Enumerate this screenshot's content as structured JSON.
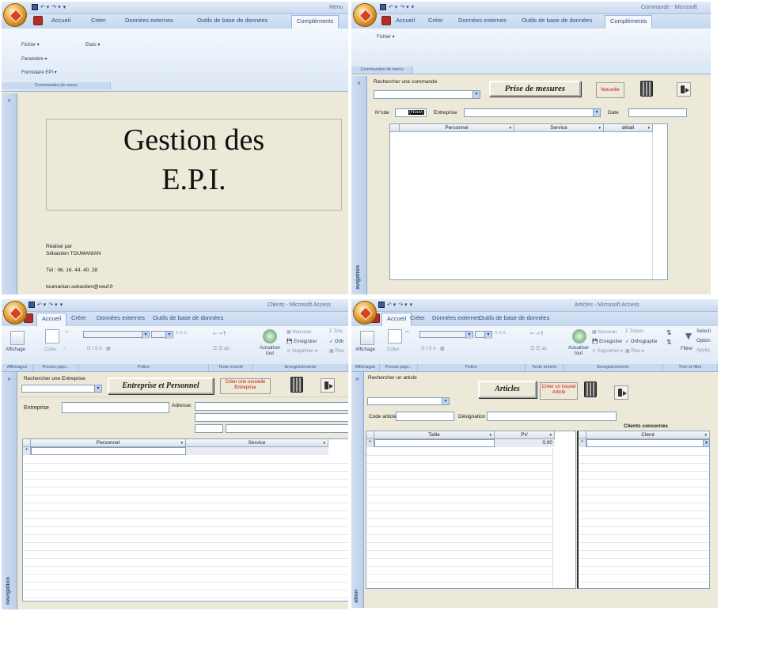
{
  "p1": {
    "window_title": "Menu",
    "tabs": [
      "Accueil",
      "Créer",
      "Données externes",
      "Outils de base de données",
      "Compléments"
    ],
    "menu": {
      "fichier": "Fichier",
      "etats": "Etats",
      "parametre": "Paramètre",
      "formulaire": "Formulaire EPI",
      "group": "Commandes de menu"
    },
    "heading1": "Gestion des",
    "heading2": "E.P.I.",
    "credit_label": "Réalisé par",
    "credit_name": "Sébastien TOUMANIAN",
    "phone": "Tél : 06. 16. 44. 40. 28",
    "email": "toumanian.sebastien@neuf.fr",
    "nav_chevron": "»"
  },
  "p2": {
    "window_title": "Commande - Microsoft",
    "tabs": [
      "Accueil",
      "Créer",
      "Données externes",
      "Outils de base de données",
      "Compléments"
    ],
    "fichier": "Fichier",
    "group": "Commandes de menu",
    "nav_label": "avigation",
    "nav_chevron": "»",
    "search_label": "Rechercher une commande",
    "title_button": "Prise de mesures",
    "new_button": "Nouvelle",
    "no_label": "N°cde",
    "no_value": "(Nouv)",
    "entreprise_label": "Entreprise",
    "date_label": "Date",
    "columns": [
      "Personnel",
      "Service",
      "détail"
    ]
  },
  "p3": {
    "window_title": "Clients - Microsoft Access",
    "tabs": [
      "Accueil",
      "Créer",
      "Données externes",
      "Outils de base de données"
    ],
    "ribbon": {
      "affichage": "Affichage",
      "coller": "Coller",
      "actualiser": "Actualiser tout",
      "nouveau": "Nouveau",
      "enregistrer": "Enregistrer",
      "supprimer": "Supprimer",
      "totaux": "Tota",
      "ortho": "Orth",
      "plus": "Plus"
    },
    "groups": [
      "Affichages",
      "Presse-papi...",
      "Police",
      "Texte enrichi",
      "Enregistrements"
    ],
    "nav_label": "navigation",
    "nav_chevron": "»",
    "search_label": "Rechercher une Entreprise",
    "title_button": "Entreprise et Personnel",
    "new_button": "Créer une nouvelle Entreprise",
    "entreprise_label": "Entreprise",
    "adresse_label": "Adresse:",
    "columns": [
      "Personnel",
      "Service"
    ],
    "row_marker": "*"
  },
  "p4": {
    "window_title": "Articles - Microsoft Access",
    "tabs": [
      "Accueil",
      "Créer",
      "Données externes",
      "Outils de base de données"
    ],
    "ribbon": {
      "affichage": "Affichage",
      "coller": "Coller",
      "actualiser": "Actualiser tout",
      "nouveau": "Nouveau",
      "enregistrer": "Enregistrer",
      "supprimer": "Supprimer",
      "totaux": "Totaux",
      "ortho": "Orthographe",
      "plus": "Plus",
      "filtrer": "Filtrer",
      "selection": "Sélecti",
      "options": "Option",
      "appliquer": "Appliq"
    },
    "groups": [
      "Affichages",
      "Presse-papi...",
      "Police",
      "Texte enrichi",
      "Enregistrements",
      "Trier et filtre"
    ],
    "nav_label": "ation",
    "nav_chevron": "»",
    "search_label": "Rechercher un article",
    "title_button": "Articles",
    "new_button": "Créer un nouvel Article",
    "code_label": "Code article",
    "designation_label": "Désignation",
    "clients_title": "Clients concernés",
    "columns": [
      "Taille",
      "PV"
    ],
    "pv_value": "0,00",
    "client_column": "Client",
    "row_marker": "*"
  }
}
